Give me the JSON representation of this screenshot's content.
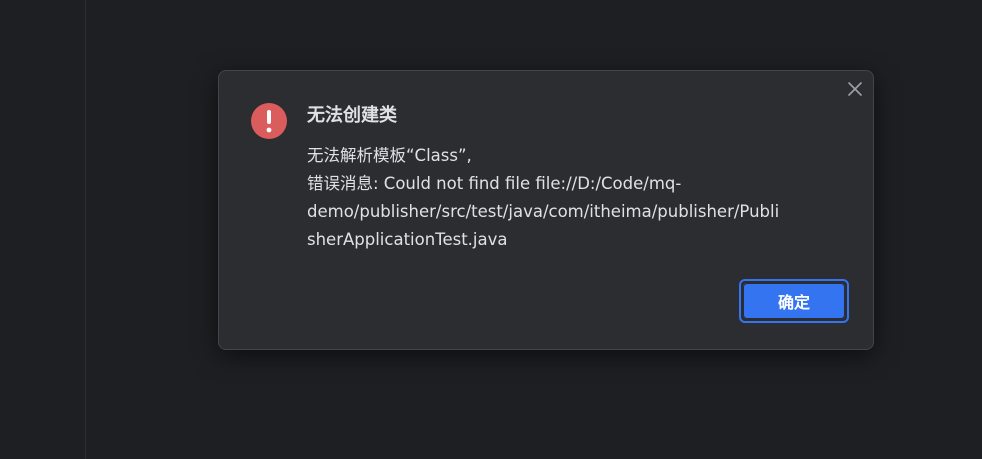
{
  "dialog": {
    "title": "无法创建类",
    "message_lines": [
      "无法解析模板“Class”,",
      "错误消息: Could not find file file://D:/Code/mq-",
      "demo/publisher/src/test/java/com/itheima/publisher/Publi",
      "sherApplicationTest.java"
    ],
    "ok_label": "确定",
    "icons": {
      "status": "error-exclamation-icon",
      "close": "close-icon"
    },
    "colors": {
      "error": "#db5c5c",
      "primary_button": "#3574f0",
      "background": "#2b2d30",
      "text": "#dfe1e5"
    }
  }
}
